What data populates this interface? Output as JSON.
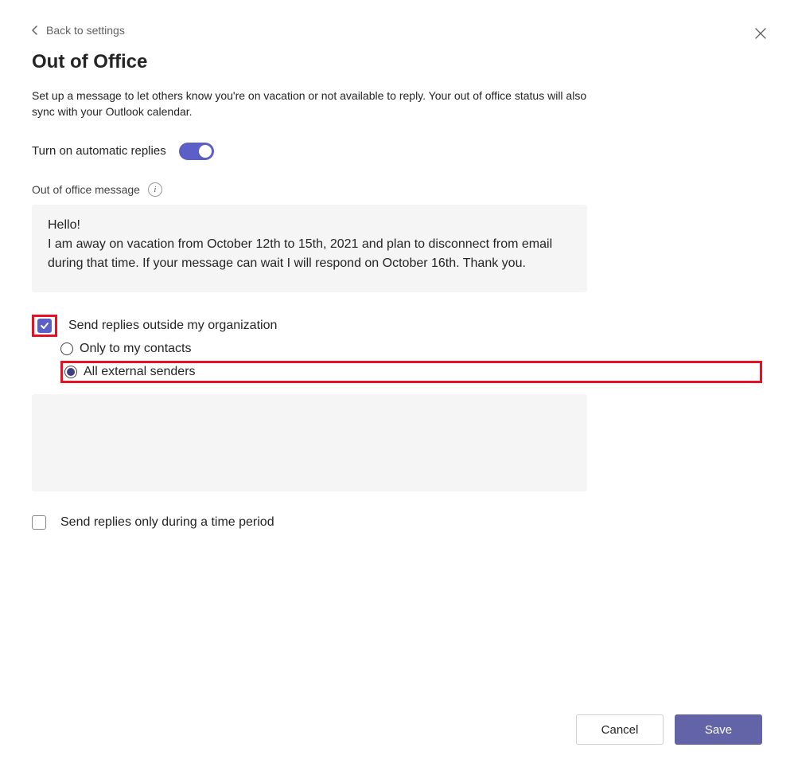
{
  "nav": {
    "back_label": "Back to settings"
  },
  "page": {
    "title": "Out of Office",
    "description": "Set up a message to let others know you're on vacation or not available to reply. Your out of office status will also sync with your Outlook calendar."
  },
  "toggle": {
    "label": "Turn on automatic replies",
    "on": true
  },
  "message": {
    "label": "Out of office message",
    "body": "Hello!\nI am away on vacation from October 12th to 15th, 2021 and plan to disconnect from email during that time. If your message can wait I will respond on October 16th. Thank you."
  },
  "outside": {
    "checkbox_label": "Send replies outside my organization",
    "checked": true,
    "options": {
      "contacts": "Only to my contacts",
      "all": "All external senders",
      "selected": "all"
    }
  },
  "period": {
    "label": "Send replies only during a time period",
    "checked": false
  },
  "buttons": {
    "cancel": "Cancel",
    "save": "Save"
  },
  "highlight": {
    "color": "#e81123"
  }
}
